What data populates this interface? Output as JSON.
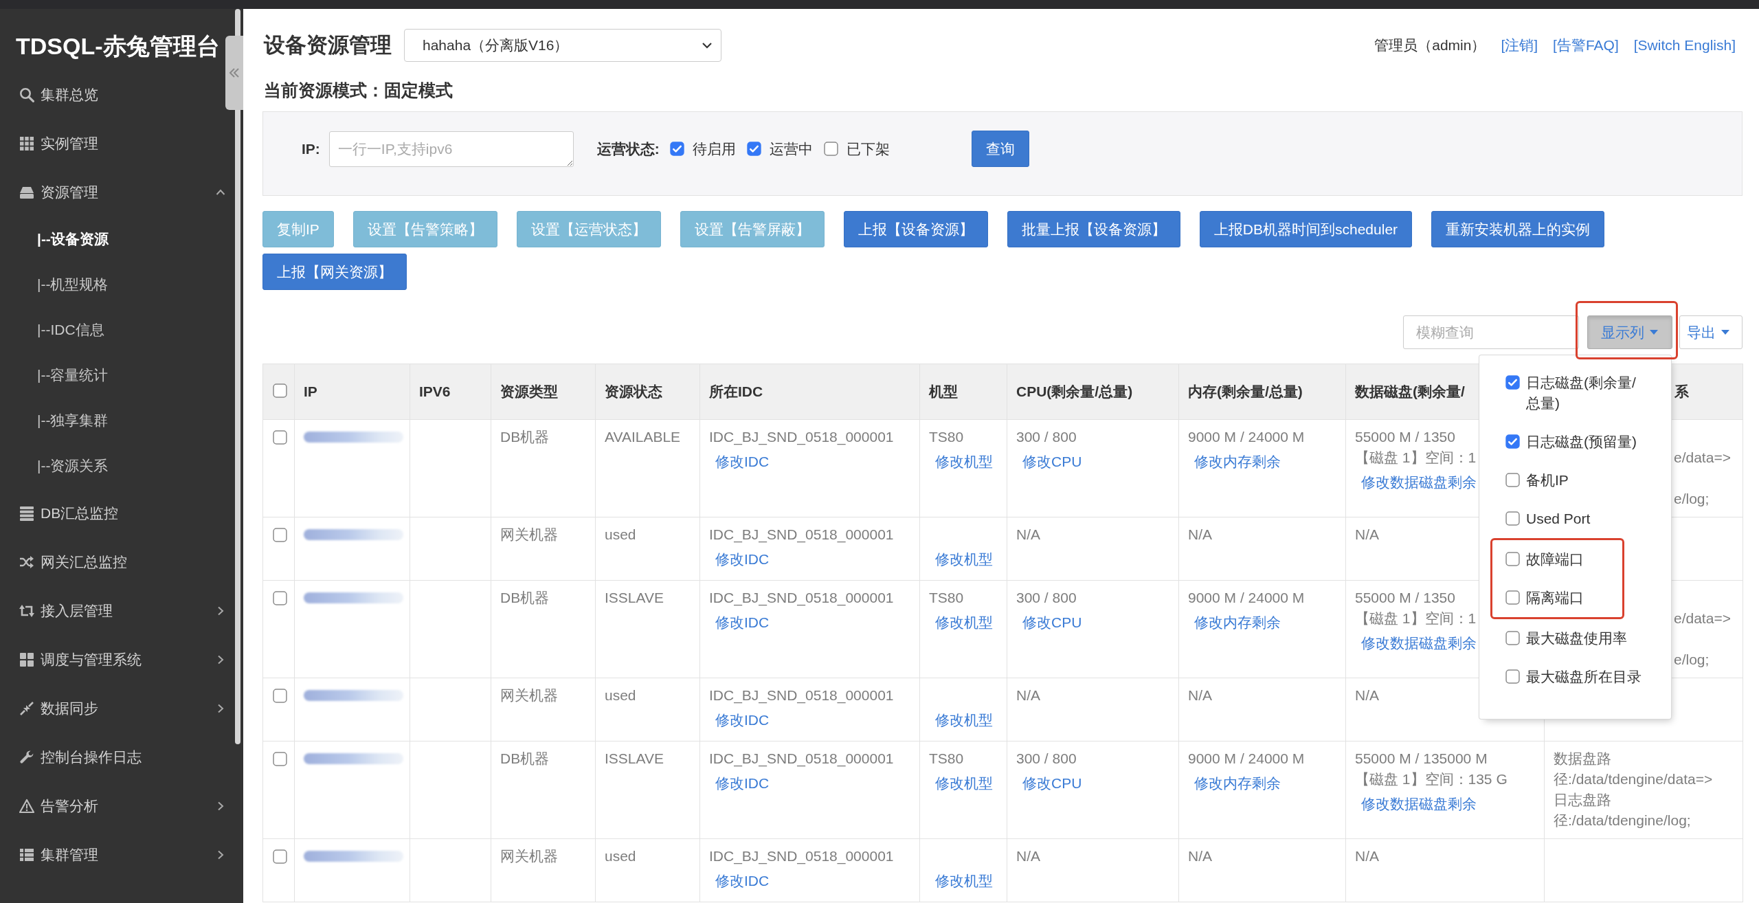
{
  "sidebar": {
    "title": "TDSQL-赤兔管理台",
    "items": [
      {
        "label": "集群总览",
        "kind": "link"
      },
      {
        "label": "实例管理",
        "kind": "link"
      },
      {
        "label": "资源管理",
        "kind": "group",
        "expanded": true,
        "children": [
          {
            "label": "|--设备资源",
            "selected": true
          },
          {
            "label": "|--机型规格",
            "selected": false
          },
          {
            "label": "|--IDC信息",
            "selected": false
          },
          {
            "label": "|--容量统计",
            "selected": false
          },
          {
            "label": "|--独享集群",
            "selected": false
          },
          {
            "label": "|--资源关系",
            "selected": false
          }
        ]
      },
      {
        "label": "DB汇总监控",
        "kind": "link"
      },
      {
        "label": "网关汇总监控",
        "kind": "link"
      },
      {
        "label": "接入层管理",
        "kind": "group",
        "expanded": false
      },
      {
        "label": "调度与管理系统",
        "kind": "group",
        "expanded": false
      },
      {
        "label": "数据同步",
        "kind": "group",
        "expanded": false
      },
      {
        "label": "控制台操作日志",
        "kind": "link"
      },
      {
        "label": "告警分析",
        "kind": "group",
        "expanded": false
      },
      {
        "label": "集群管理",
        "kind": "group",
        "expanded": false
      }
    ]
  },
  "header": {
    "title": "设备资源管理",
    "cluster_select": {
      "value": "hahaha（分离版V16）"
    },
    "user": "管理员（admin）",
    "links": [
      "[注销]",
      "[告警FAQ]",
      "[Switch English]"
    ]
  },
  "resource_mode": "当前资源模式：固定模式",
  "filter": {
    "ip_label": "IP:",
    "ip_field": {
      "placeholder": "一行一IP,支持ipv6"
    },
    "status_label": "运营状态:",
    "statuses": [
      {
        "label": "待启用",
        "checked": true
      },
      {
        "label": "运营中",
        "checked": true
      },
      {
        "label": "已下架",
        "checked": false
      }
    ],
    "query_button": "查询"
  },
  "actions": [
    {
      "label": "复制IP",
      "disabled": true
    },
    {
      "label": "设置【告警策略】",
      "disabled": true
    },
    {
      "label": "设置【运营状态】",
      "disabled": true
    },
    {
      "label": "设置【告警屏蔽】",
      "disabled": true
    },
    {
      "label": "上报【设备资源】",
      "disabled": false
    },
    {
      "label": "批量上报【设备资源】",
      "disabled": false
    },
    {
      "label": "上报DB机器时间到scheduler",
      "disabled": false
    },
    {
      "label": "重新安装机器上的实例",
      "disabled": false
    },
    {
      "label": "上报【网关资源】",
      "disabled": false
    }
  ],
  "toolbar": {
    "search": {
      "placeholder": "模糊查询"
    },
    "columns_button": {
      "label": "显示列",
      "expanded": true,
      "highlighted": true,
      "menu": [
        {
          "label": "日志磁盘(剩余量/总量)",
          "checked": true,
          "highlighted": false
        },
        {
          "label": "日志磁盘(预留量)",
          "checked": true,
          "highlighted": false
        },
        {
          "label": "备机IP",
          "checked": false,
          "highlighted": false
        },
        {
          "label": "Used Port",
          "checked": false,
          "highlighted": false
        },
        {
          "label": "故障端口",
          "checked": false,
          "highlighted": true
        },
        {
          "label": "隔离端口",
          "checked": false,
          "highlighted": true
        },
        {
          "label": "最大磁盘使用率",
          "checked": false,
          "highlighted": false
        },
        {
          "label": "最大磁盘所在目录",
          "checked": false,
          "highlighted": false
        }
      ]
    },
    "export_button": "导出"
  },
  "table": {
    "select_all": false,
    "columns": [
      "IP",
      "IPV6",
      "资源类型",
      "资源状态",
      "所在IDC",
      "机型",
      "CPU(剩余量/总量)",
      "内存(剩余量/总量)",
      "数据磁盘(剩余量/",
      "系"
    ],
    "rows": [
      {
        "checked": false,
        "ip_blurred": true,
        "type": "DB机器",
        "status": "AVAILABLE",
        "idc": "IDC_BJ_SND_0518_000001",
        "idc_link": "修改IDC",
        "model": "TS80",
        "model_link": "修改机型",
        "cpu": "300 / 800",
        "cpu_link": "修改CPU",
        "memory": "9000 M / 24000 M",
        "memory_link": "修改内存剩余",
        "disk": [
          "55000 M / 1350",
          "【磁盘 1】空间：1"
        ],
        "disk_link": "修改数据磁盘剩余",
        "relation": {
          "covered": true,
          "lines": [
            "e/data=>",
            "e/log;"
          ]
        }
      },
      {
        "checked": false,
        "ip_blurred": true,
        "type": "网关机器",
        "status": "used",
        "idc": "IDC_BJ_SND_0518_000001",
        "idc_link": "修改IDC",
        "model_link": "修改机型",
        "cpu": "N/A",
        "memory": "N/A",
        "disk": [
          "N/A"
        ]
      },
      {
        "checked": false,
        "ip_blurred": true,
        "type": "DB机器",
        "status": "ISSLAVE",
        "idc": "IDC_BJ_SND_0518_000001",
        "idc_link": "修改IDC",
        "model": "TS80",
        "model_link": "修改机型",
        "cpu": "300 / 800",
        "cpu_link": "修改CPU",
        "memory": "9000 M / 24000 M",
        "memory_link": "修改内存剩余",
        "disk": [
          "55000 M / 1350",
          "【磁盘 1】空间：1"
        ],
        "disk_link": "修改数据磁盘剩余",
        "relation": {
          "covered": true,
          "lines": [
            "e/data=>",
            "e/log;"
          ]
        }
      },
      {
        "checked": false,
        "ip_blurred": true,
        "type": "网关机器",
        "status": "used",
        "idc": "IDC_BJ_SND_0518_000001",
        "idc_link": "修改IDC",
        "model_link": "修改机型",
        "cpu": "N/A",
        "memory": "N/A",
        "disk": [
          "N/A"
        ]
      },
      {
        "checked": false,
        "ip_blurred": true,
        "type": "DB机器",
        "status": "ISSLAVE",
        "idc": "IDC_BJ_SND_0518_000001",
        "idc_link": "修改IDC",
        "model": "TS80",
        "model_link": "修改机型",
        "cpu": "300 / 800",
        "cpu_link": "修改CPU",
        "memory": "9000 M / 24000 M",
        "memory_link": "修改内存剩余",
        "disk": [
          "55000 M / 135000 M",
          "【磁盘 1】空间：135 G"
        ],
        "disk_link": "修改数据磁盘剩余",
        "relation": {
          "covered": false,
          "lines": [
            "数据盘路径:/data/tdengine/data=>",
            "日志盘路径:/data/tdengine/log;"
          ]
        }
      },
      {
        "checked": false,
        "ip_blurred": true,
        "type": "网关机器",
        "status": "used",
        "idc": "IDC_BJ_SND_0518_000001",
        "idc_link": "修改IDC",
        "model_link": "修改机型",
        "cpu": "N/A",
        "memory": "N/A",
        "disk": [
          "N/A"
        ]
      }
    ]
  }
}
